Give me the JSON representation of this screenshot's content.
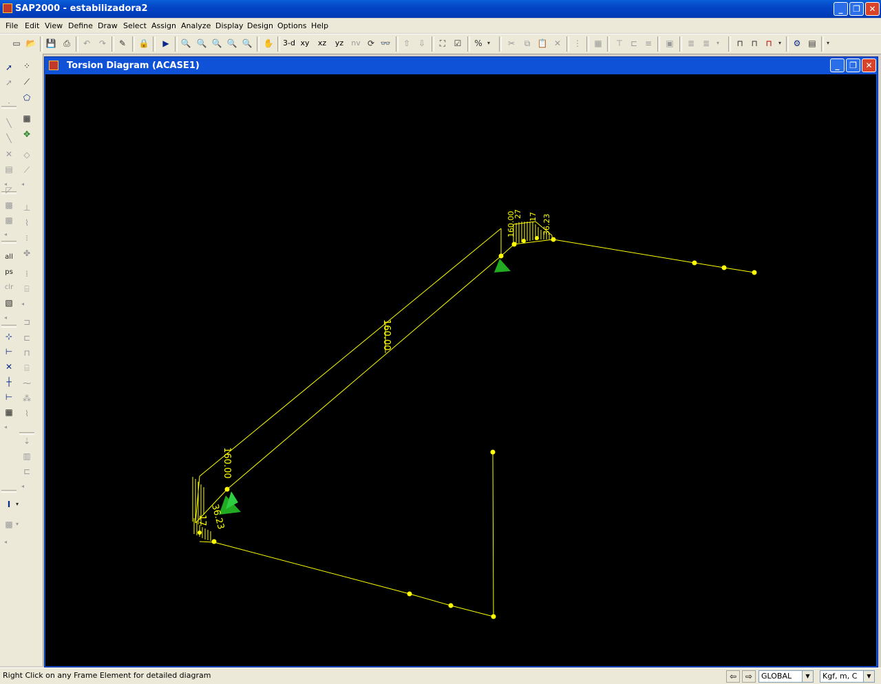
{
  "app": {
    "title": "SAP2000 - estabilizadora2"
  },
  "window_controls": {
    "min": "_",
    "max": "❐",
    "close": "✕"
  },
  "menus": [
    "File",
    "Edit",
    "View",
    "Define",
    "Draw",
    "Select",
    "Assign",
    "Analyze",
    "Display",
    "Design",
    "Options",
    "Help"
  ],
  "toolbar": {
    "btn_3d": "3-d",
    "btn_xy": "xy",
    "btn_xz": "xz",
    "btn_yz": "yz",
    "btn_nv": "nv"
  },
  "left_toolbar": {
    "all_label": "all",
    "ps_label": "ps",
    "clr_label": "clr"
  },
  "child_window": {
    "title": "Torsion Diagram  (ACASE1)"
  },
  "diagram_labels": {
    "mid_value": "160.00",
    "top_value": "160.00",
    "top_value2": "27",
    "top_value3": "17",
    "top_value4": "36.23",
    "bottom_value": "160.00",
    "bottom_value2": "36.23",
    "bottom_value3": "17"
  },
  "colors": {
    "diagram": "#ffff00",
    "support": "#22aa22",
    "background": "#000000"
  },
  "status": {
    "message": "Right Click on any Frame Element for detailed diagram",
    "coord_system": "GLOBAL",
    "units": "Kgf, m, C"
  }
}
